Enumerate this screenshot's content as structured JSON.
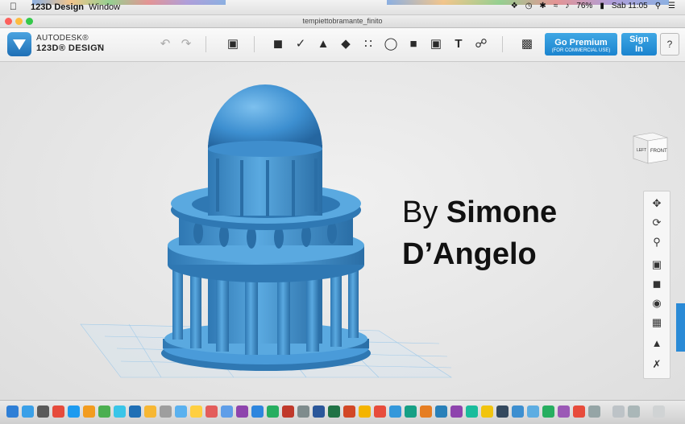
{
  "menubar": {
    "app_name": "123D Design",
    "window_menu": "Window",
    "battery": "76%",
    "clock": "Sab 11:05"
  },
  "window": {
    "title": "tempiettobramante_finito"
  },
  "toolbar": {
    "brand_line1": "AUTODESK®",
    "brand_line2": "123D® DESIGN",
    "premium_label": "Go Premium",
    "premium_sub": "(FOR COMMERCIAL USE)",
    "signin_label": "Sign In",
    "help_label": "?"
  },
  "overlay": {
    "by": "By",
    "name_line1": "Simone",
    "name_line2": "D’Angelo"
  },
  "viewcube": {
    "left": "LEFT",
    "front": "FRONT"
  },
  "colors": {
    "accent": "#1b84cf",
    "model": "#3d8fd0"
  }
}
